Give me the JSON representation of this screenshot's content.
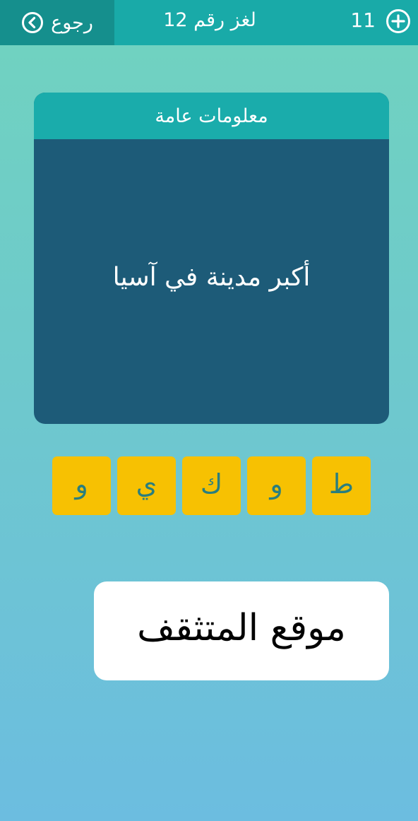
{
  "header": {
    "back_label": "رجوع",
    "back_icon": "chevron-left-circle-icon",
    "level_title": "لغز رقم 12",
    "coin_count": "11",
    "add_icon": "plus-circle-icon"
  },
  "card": {
    "category": "معلومات عامة",
    "question": "أكبر مدينة في آسيا"
  },
  "tiles": [
    "ط",
    "و",
    "ك",
    "ي",
    "و"
  ],
  "watermark": "موقع المتثقف",
  "colors": {
    "topbar": "#19aaa8",
    "back_button": "#158f8d",
    "card_header": "#1aacab",
    "card_body": "#1d5b78",
    "tile": "#f7c102",
    "tile_text": "#2a7e7e"
  }
}
